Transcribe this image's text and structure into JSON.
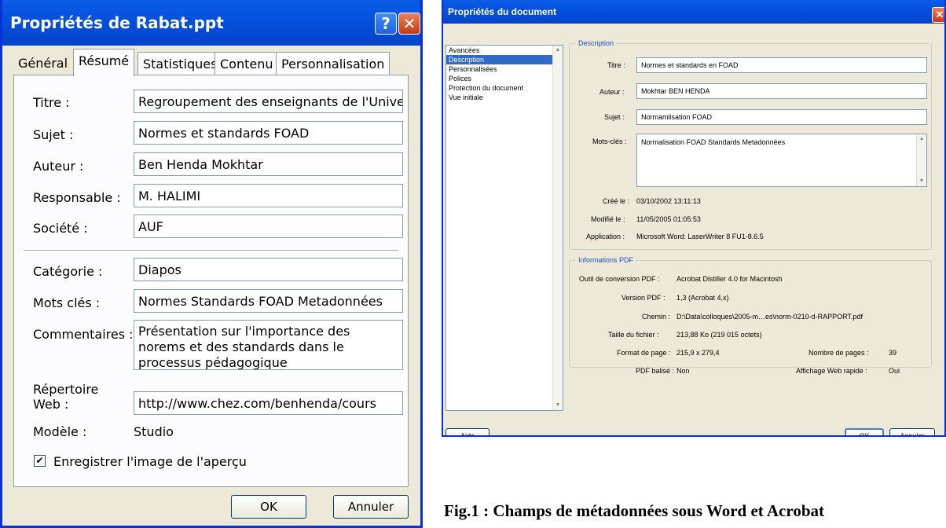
{
  "left_dialog": {
    "title": "Propriétés de Rabat.ppt",
    "help_label": "?",
    "close_label": "✕",
    "tabs": [
      "Général",
      "Résumé",
      "Statistiques",
      "Contenu",
      "Personnalisation"
    ],
    "active_tab": "Résumé",
    "fields": [
      {
        "label": "Titre :",
        "value": "Regroupement des enseignants de l'Université I"
      },
      {
        "label": "Sujet :",
        "value": "Normes et standards FOAD"
      },
      {
        "label": "Auteur :",
        "value": "Ben Henda Mokhtar"
      },
      {
        "label": "Responsable :",
        "value": "M. HALIMI"
      },
      {
        "label": "Société :",
        "value": "AUF"
      },
      {
        "label": "Catégorie :",
        "value": "Diapos"
      },
      {
        "label": "Mots clés :",
        "value": "Normes Standards FOAD Metadonnées"
      }
    ],
    "comments_label": "Commentaires :",
    "comments_value": "Présentation sur l'importance des norems et des standards dans le processus pédagogique",
    "web_dir_label": "Répertoire Web :",
    "web_dir_value": "http://www.chez.com/benhenda/cours",
    "template_label": "Modèle :",
    "template_value": "Studio",
    "checkbox_mark": "✔",
    "checkbox_label": "Enregistrer l'image de l'aperçu",
    "checkbox_checked": true,
    "ok_label": "OK",
    "cancel_label": "Annuler"
  },
  "right_dialog": {
    "title": "Propriétés du document",
    "close_label": "✕",
    "categories": [
      "Avancées",
      "Description",
      "Personnalisées",
      "Polices",
      "Protection du document",
      "Vue initiale"
    ],
    "selected_category": "Description",
    "description_legend": "Description",
    "title_label": "Titre :",
    "title_value": "Normes et standards en FOAD",
    "author_label": "Auteur :",
    "author_value": "Mokhtar BEN HENDA",
    "subject_label": "Sujet :",
    "subject_value": "Normamlisation FOAD",
    "keywords_label": "Mots-clés :",
    "keywords_value": "Normalisation FOAD Standards Metadonnées",
    "created_label": "Créé le :",
    "created_value": "03/10/2002 13:11:13",
    "modified_label": "Modifié le :",
    "modified_value": "11/05/2005 01:05:53",
    "application_label": "Application :",
    "application_value": "Microsoft Word: LaserWriter 8 FU1-8.6.5",
    "pdf_legend": "Informations PDF",
    "pdf_producer_label": "Outil de conversion PDF :",
    "pdf_producer_value": "Acrobat Distiller 4.0 for Macintosh",
    "pdf_version_label": "Version PDF :",
    "pdf_version_value": "1,3 (Acrobat 4,x)",
    "path_label": "Chemin :",
    "path_value": "D:\\Data\\colloques\\2005-m…es\\norm-0210-d-RAPPORT.pdf",
    "size_label": "Taille du fichier :",
    "size_value": "213,88 Ko (219 015 octets)",
    "page_format_label": "Format de page :",
    "page_format_value": "215,9 x 279,4",
    "page_count_label": "Nombre de pages :",
    "page_count_value": "39",
    "tagged_label": "PDF balisé :",
    "tagged_value": "Non",
    "fast_web_label": "Affichage Web rapide :",
    "fast_web_value": "Oui",
    "help_button": "Aide",
    "ok_label": "OK",
    "cancel_label": "Annuler"
  },
  "caption": "Fig.1 : Champs de métadonnées sous Word et Acrobat"
}
